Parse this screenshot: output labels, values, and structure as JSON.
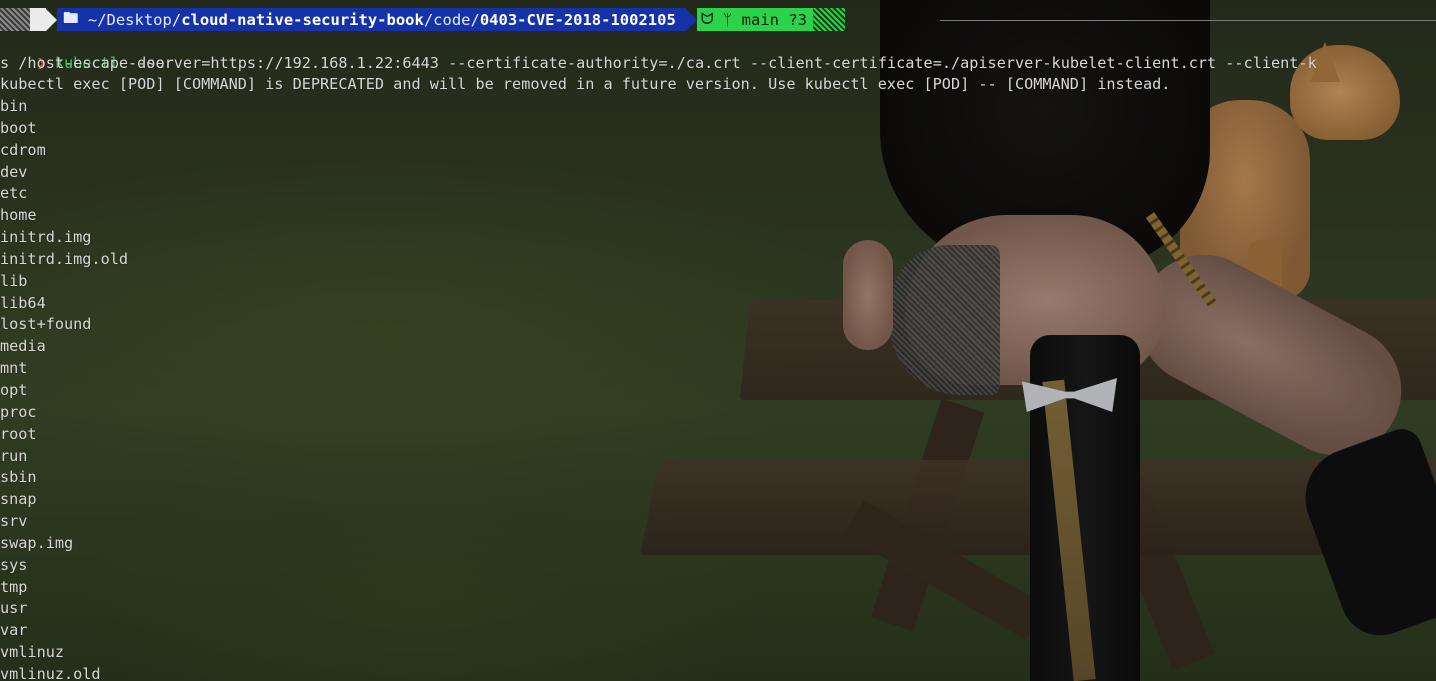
{
  "prompt": {
    "apple_glyph": "",
    "folder_glyph": "🖿",
    "path_prefix": "~/Desktop/",
    "path_repo": "cloud-native-security-book",
    "path_mid": "/code/",
    "path_dir": "0403-CVE-2018-1002105",
    "git_glyph": "ᗢ",
    "branch_glyph": "ᛘ",
    "branch": "main",
    "status": "?3"
  },
  "command": {
    "caret": "❯",
    "program": "kubectl",
    "args": " --server=https://192.168.1.22:6443 --certificate-authority=./ca.crt --client-certificate=./apiserver-kubelet-client.crt --client-k"
  },
  "ls_line": "s /host-escape-door",
  "warning": "kubectl exec [POD] [COMMAND] is DEPRECATED and will be removed in a future version. Use kubectl exec [POD] -- [COMMAND] instead.",
  "listing": [
    "bin",
    "boot",
    "cdrom",
    "dev",
    "etc",
    "home",
    "initrd.img",
    "initrd.img.old",
    "lib",
    "lib64",
    "lost+found",
    "media",
    "mnt",
    "opt",
    "proc",
    "root",
    "run",
    "sbin",
    "snap",
    "srv",
    "swap.img",
    "sys",
    "tmp",
    "usr",
    "var",
    "vmlinuz",
    "vmlinuz.old"
  ],
  "colors": {
    "path_bg": "#1532a8",
    "git_bg": "#2bd34a",
    "apple_bg": "#ebebeb",
    "caret": "#e0503c",
    "kubectl": "#3fd35a",
    "text": "#d8d8d8"
  }
}
